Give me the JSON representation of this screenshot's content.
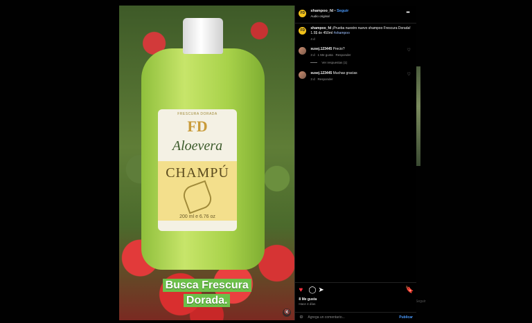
{
  "post": {
    "username": "shampoo_fd",
    "follow_label": "Seguir",
    "audio": "Audio original",
    "more_icon": "more-icon",
    "caption_username": "shampoo_fd",
    "caption_text": "¡Prueba nuestro nuevo shampoo Frescura Dorada! 1.5$ de 450ml",
    "caption_hashtag": "#shampoo",
    "caption_time": "4 d"
  },
  "comments": [
    {
      "username": "susej.123445",
      "text": "Precio?",
      "time": "3 d",
      "likes": "1 Me gusta",
      "reply_label": "Responder"
    },
    {
      "username": "susej.123445",
      "text": "Muchas gracias",
      "time": "3 d",
      "reply_label": "Responder"
    }
  ],
  "replies_label": "Ver respuestas (1)",
  "actions": {
    "likes": "8 Me gusta",
    "time_ago": "Hace 4 días"
  },
  "comment_box": {
    "placeholder": "Agrega un comentario...",
    "publish_label": "Publicar"
  },
  "media": {
    "label_top": "FRESCURA DORADA",
    "label_logo": "FD",
    "label_brand": "Aloevera",
    "label_product": "CHAMPÚ",
    "label_size": "200 ml e 6.76 oz",
    "caption_line1": "Busca Frescura",
    "caption_line2": "Dorada."
  },
  "background": {
    "peek_label": "Seguir"
  },
  "colors": {
    "accent": "#4a9bff",
    "like_red": "#ff3040",
    "caption_green": "#6cc04a"
  }
}
